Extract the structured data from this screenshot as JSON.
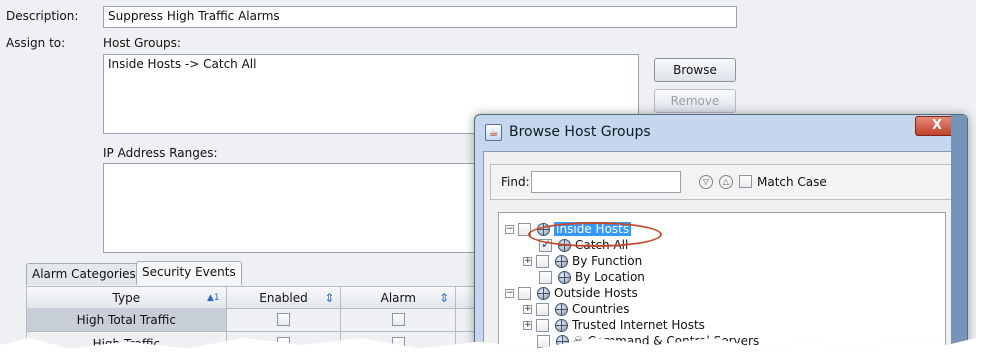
{
  "form": {
    "description_label": "Description:",
    "description_value": "Suppress High Traffic Alarms",
    "assign_label": "Assign to:",
    "host_groups_label": "Host Groups:",
    "host_groups_value": "Inside Hosts -> Catch All",
    "ip_ranges_label": "IP Address Ranges:",
    "browse_button": "Browse",
    "remove_button": "Remove"
  },
  "tabs": [
    {
      "label": "Alarm Categories"
    },
    {
      "label": "Security Events",
      "active": true
    }
  ],
  "table": {
    "columns": [
      "Type",
      "Enabled",
      "Alarm"
    ],
    "sort_indicator": "▲1",
    "sort_icon": "⇕",
    "rows": [
      {
        "type": "High Total Traffic",
        "enabled": false,
        "alarm": false
      },
      {
        "type": "High Traffic",
        "enabled": false,
        "alarm": false
      }
    ]
  },
  "dialog": {
    "title": "Browse Host Groups",
    "close_label": "X",
    "find_label": "Find:",
    "find_value": "",
    "match_case_label": "Match Case",
    "tree": [
      {
        "label": "Inside Hosts",
        "highlighted": true,
        "checked": false
      },
      {
        "label": "Catch All",
        "checked": true
      },
      {
        "label": "By Function",
        "checked": false
      },
      {
        "label": "By Location",
        "checked": false
      },
      {
        "label": "Outside Hosts",
        "checked": false
      },
      {
        "label": "Countries",
        "checked": false
      },
      {
        "label": "Trusted Internet Hosts",
        "checked": false
      },
      {
        "label": "Command & Control Servers",
        "checked": false
      }
    ]
  }
}
